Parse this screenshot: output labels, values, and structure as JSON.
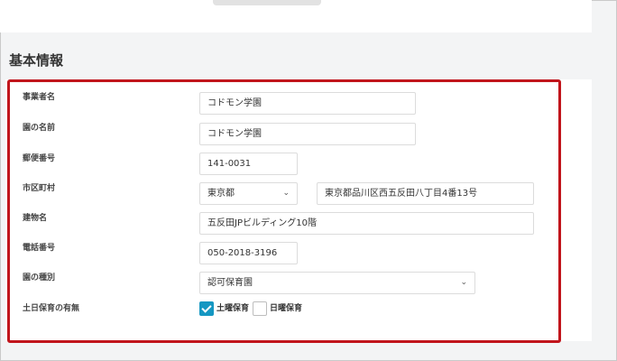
{
  "section_title": "基本情報",
  "fields": {
    "business_name": {
      "label": "事業者名",
      "value": "コドモン学園"
    },
    "facility_name": {
      "label": "園の名前",
      "value": "コドモン学園"
    },
    "postal_code": {
      "label": "郵便番号",
      "value": "141-0031"
    },
    "city": {
      "label": "市区町村",
      "prefecture": "東京都",
      "address": "東京都品川区西五反田八丁目4番13号"
    },
    "building": {
      "label": "建物名",
      "value": "五反田JPビルディング10階"
    },
    "phone": {
      "label": "電話番号",
      "value": "050-2018-3196"
    },
    "facility_type": {
      "label": "園の種別",
      "value": "認可保育園"
    },
    "weekend_care": {
      "label": "土日保育の有無",
      "options": [
        {
          "label": "土曜保育",
          "checked": true
        },
        {
          "label": "日曜保育",
          "checked": false
        }
      ]
    }
  },
  "colors": {
    "highlight": "#c1151c",
    "checkbox_accent": "#1597c2"
  },
  "icons": {
    "dropdown": "chevron-down-icon",
    "check": "check-icon"
  }
}
